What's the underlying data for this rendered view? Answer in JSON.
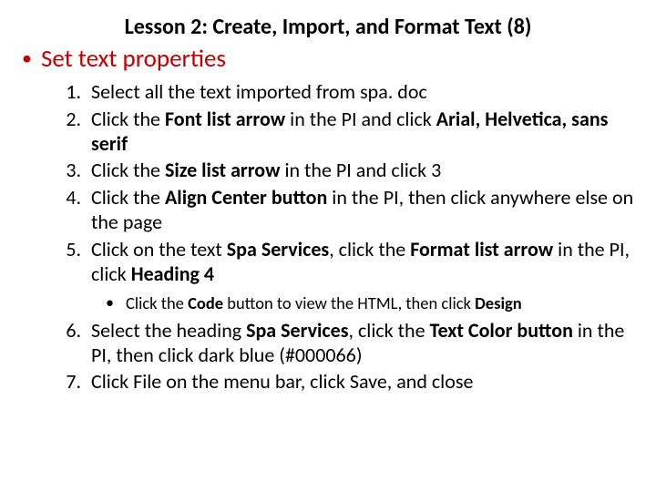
{
  "title": "Lesson 2: Create, Import, and Format Text (8)",
  "bullet": "Set text properties",
  "steps": {
    "s1": "Select all the text imported from spa. doc",
    "s2a": "Click the ",
    "s2b": "Font list arrow",
    "s2c": " in the PI and click ",
    "s2d": "Arial, Helvetica, sans serif",
    "s3a": "Click the ",
    "s3b": "Size list arrow",
    "s3c": " in the PI and click 3",
    "s4a": "Click the ",
    "s4b": "Align Center button",
    "s4c": " in the PI, then click anywhere else on the page",
    "s5a": "Click on the text ",
    "s5b": "Spa Services",
    "s5c": ", click the ",
    "s5d": "Format list arrow",
    "s5e": " in the PI, click ",
    "s5f": "Heading 4",
    "sub_a": "Click the ",
    "sub_b": "Code",
    "sub_c": " button to view the HTML, then click ",
    "sub_d": "Design",
    "s6a": "Select the heading ",
    "s6b": "Spa Services",
    "s6c": ", click the ",
    "s6d": "Text Color button",
    "s6e": " in the PI, then click dark blue (#000066)",
    "s7": "Click File on the menu bar, click Save, and close"
  }
}
